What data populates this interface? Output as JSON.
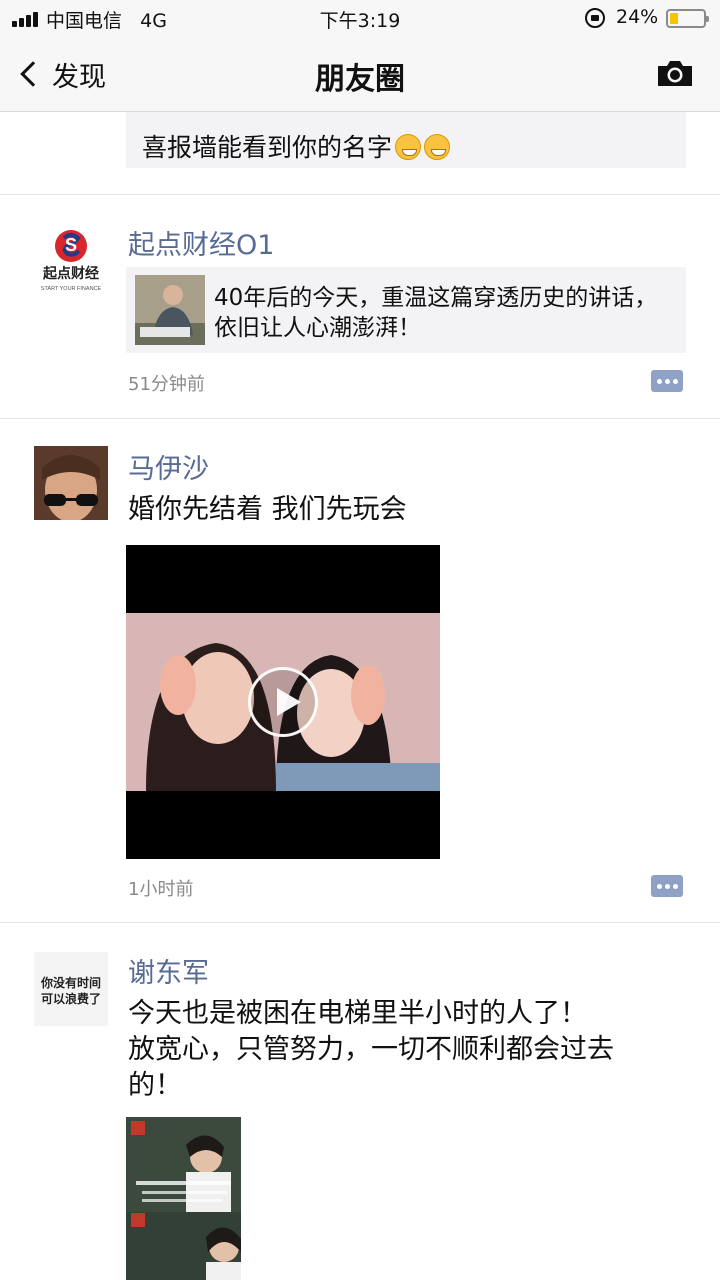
{
  "status_bar": {
    "carrier": "中国电信",
    "network": "4G",
    "time": "下午3:19",
    "battery_percent": "24%",
    "battery_level": 0.24
  },
  "nav": {
    "back_label": "发现",
    "title": "朋友圈",
    "camera_icon": "camera-icon"
  },
  "previous_post": {
    "text_line2": "喜报墙能看到你的名字",
    "emojis": [
      "grinning-face-emoji",
      "grinning-face-emoji"
    ]
  },
  "posts": [
    {
      "name": "起点财经O1",
      "avatar": {
        "logo_text": "起点财经",
        "logo_subtext": "START YOUR FINANCE",
        "logo_letter": "S"
      },
      "link": {
        "text": "40年后的今天，重温这篇穿透历史的讲话，依旧让人心潮澎湃！"
      },
      "time": "51分钟前"
    },
    {
      "name": "马伊沙",
      "text": "婚你先结着 我们先玩会",
      "media": "video",
      "time": "1小时前"
    },
    {
      "name": "谢东军",
      "avatar": {
        "text_line1": "你没有时间",
        "text_line2": "可以浪费了"
      },
      "text_line1": "今天也是被困在电梯里半小时的人了！",
      "text_line2": "放宽心，只管努力，一切不顺利都会过去",
      "text_line3": "的！",
      "media": "image"
    }
  ]
}
